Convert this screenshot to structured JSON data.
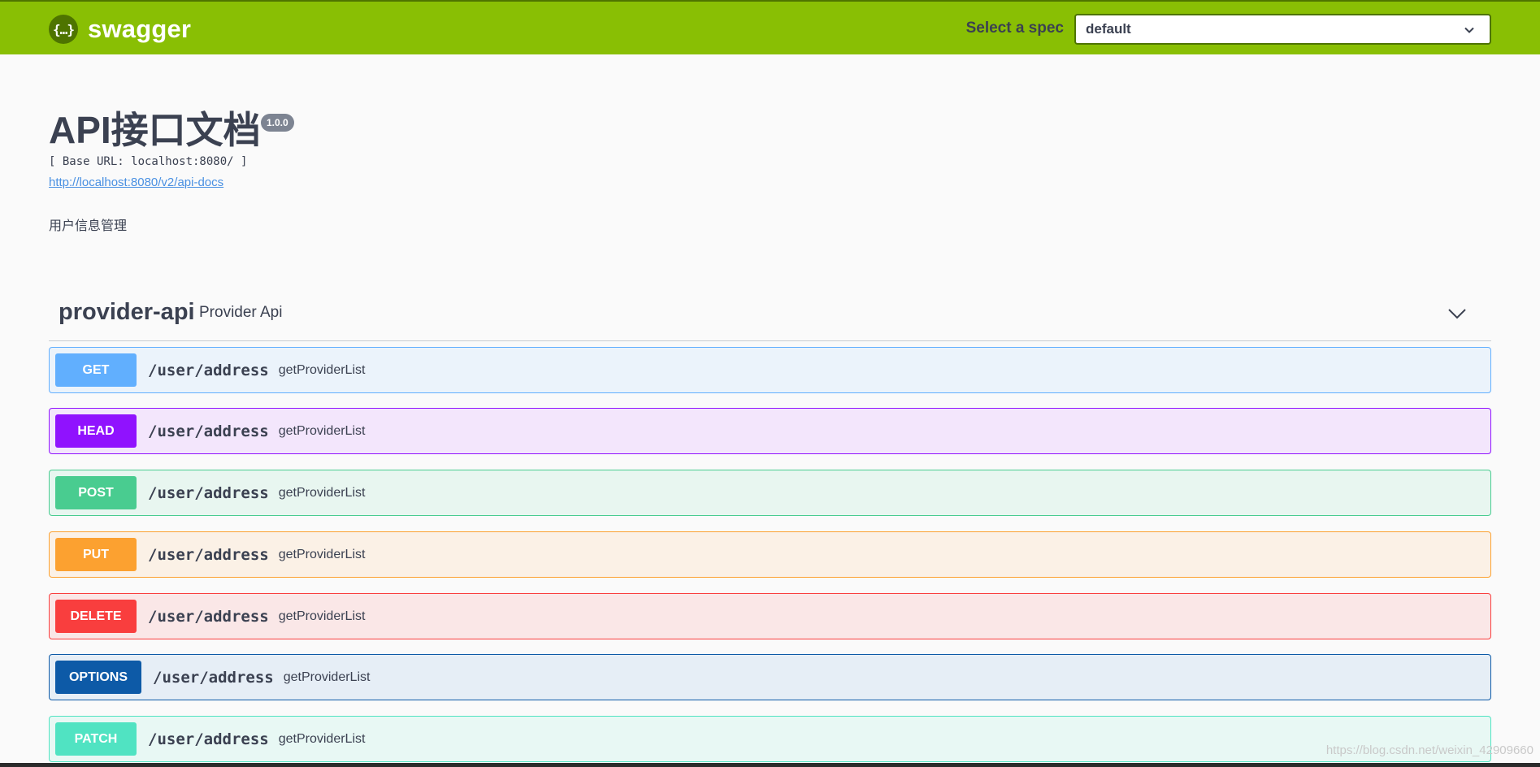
{
  "topbar": {
    "logo_glyph": "{…}",
    "logo_text": "swagger",
    "spec_label": "Select a spec",
    "spec_selected": "default"
  },
  "info": {
    "title": "API接口文档",
    "version": "1.0.0",
    "base_url": "[ Base URL: localhost:8080/ ]",
    "docs_link": "http://localhost:8080/v2/api-docs",
    "description": "用户信息管理"
  },
  "tag": {
    "name": "provider-api",
    "description": "Provider Api"
  },
  "operations": [
    {
      "method": "GET",
      "path": "/user/address",
      "summary": "getProviderList",
      "color": "#61affe"
    },
    {
      "method": "HEAD",
      "path": "/user/address",
      "summary": "getProviderList",
      "color": "#9012fe"
    },
    {
      "method": "POST",
      "path": "/user/address",
      "summary": "getProviderList",
      "color": "#49cc90"
    },
    {
      "method": "PUT",
      "path": "/user/address",
      "summary": "getProviderList",
      "color": "#fca130"
    },
    {
      "method": "DELETE",
      "path": "/user/address",
      "summary": "getProviderList",
      "color": "#f93e3e"
    },
    {
      "method": "OPTIONS",
      "path": "/user/address",
      "summary": "getProviderList",
      "color": "#0d5aa7"
    },
    {
      "method": "PATCH",
      "path": "/user/address",
      "summary": "getProviderList",
      "color": "#50e3c2"
    }
  ],
  "watermark": "https://blog.csdn.net/weixin_42909660",
  "icons": {
    "logo": "swagger-logo-icon",
    "spec_dropdown": "chevron-down-icon",
    "tag_toggle": "chevron-down-icon"
  }
}
